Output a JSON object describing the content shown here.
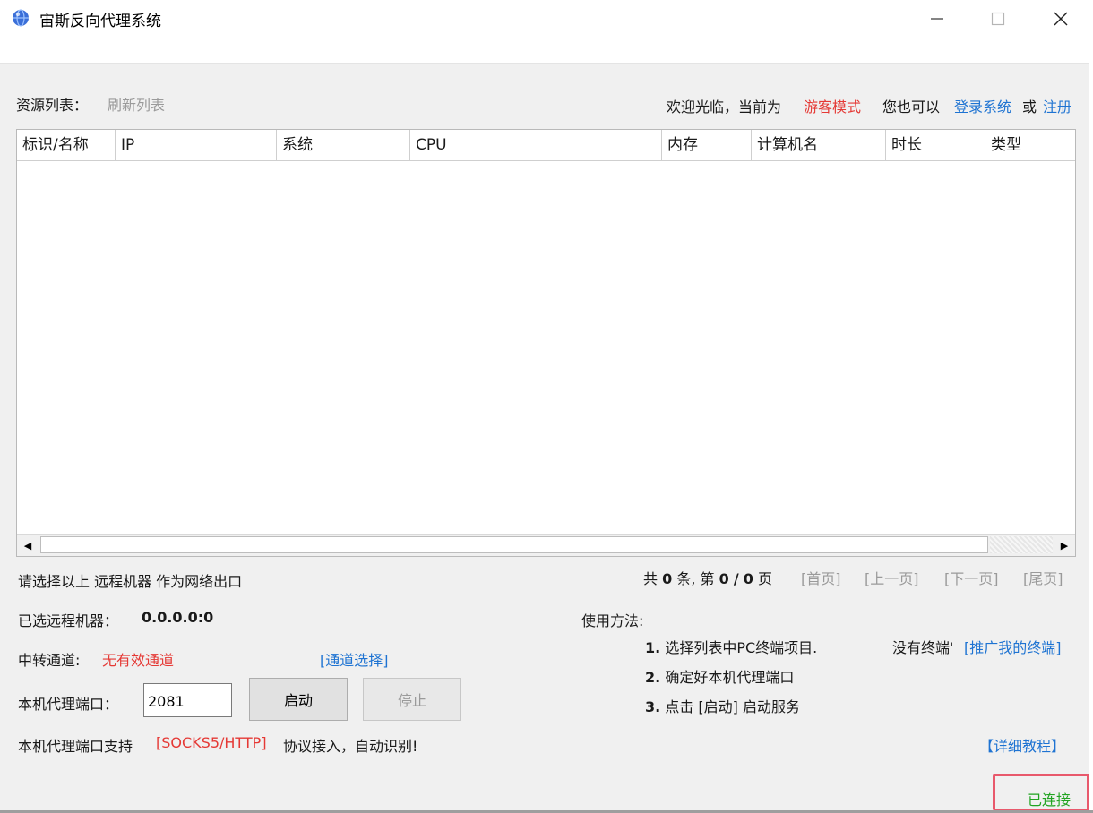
{
  "window": {
    "title": "宙斯反向代理系统",
    "controls": {
      "minimize": "—",
      "maximize": "☐",
      "close": "✕"
    }
  },
  "header": {
    "resource_list_label": "资源列表：",
    "refresh_link": "刷新列表",
    "welcome_text": "欢迎光临，当前为",
    "mode_text": "游客模式",
    "also_text": "您也可以",
    "login_link": "登录系统",
    "or_text": "或",
    "register_link": "注册"
  },
  "table": {
    "columns": [
      "标识/名称",
      "IP",
      "系统",
      "CPU",
      "内存",
      "计算机名",
      "时长",
      "类型"
    ],
    "rows": []
  },
  "pagination": {
    "hint": "请选择以上 远程机器 作为网络出口",
    "total_prefix": "共",
    "total_count": "0",
    "total_unit": "条, 第",
    "current_page": "0",
    "slash": "/",
    "page_total": "0",
    "page_unit": "页",
    "first": "[首页]",
    "prev": "[上一页]",
    "next": "[下一页]",
    "last": "[尾页]"
  },
  "config": {
    "selected_label": "已选远程机器：",
    "selected_value": "0.0.0.0:0",
    "relay_label": "中转通道:",
    "relay_value": "无有效通道",
    "relay_select_link": "[通道选择]",
    "port_label": "本机代理端口：",
    "port_value": "2081",
    "start_button": "启动",
    "stop_button": "停止",
    "support_prefix": "本机代理端口支持",
    "support_protocols": "[SOCKS5/HTTP]",
    "support_suffix": "协议接入，自动识别!"
  },
  "usage": {
    "title": "使用方法:",
    "steps": [
      {
        "num": "1.",
        "text": "选择列表中PC终端项目."
      },
      {
        "num": "2.",
        "text": "确定好本机代理端口"
      },
      {
        "num": "3.",
        "text": "点击 [启动] 启动服务"
      }
    ],
    "no_terminal_text": "没有终端'",
    "promote_link": "[推广我的终端]",
    "tutorial_link": "【详细教程】"
  },
  "status": {
    "text": "已连接"
  },
  "colors": {
    "accent_red": "#e53935",
    "link_blue": "#1e73d2",
    "status_green": "#21a321",
    "highlight_border": "#e8596c"
  }
}
